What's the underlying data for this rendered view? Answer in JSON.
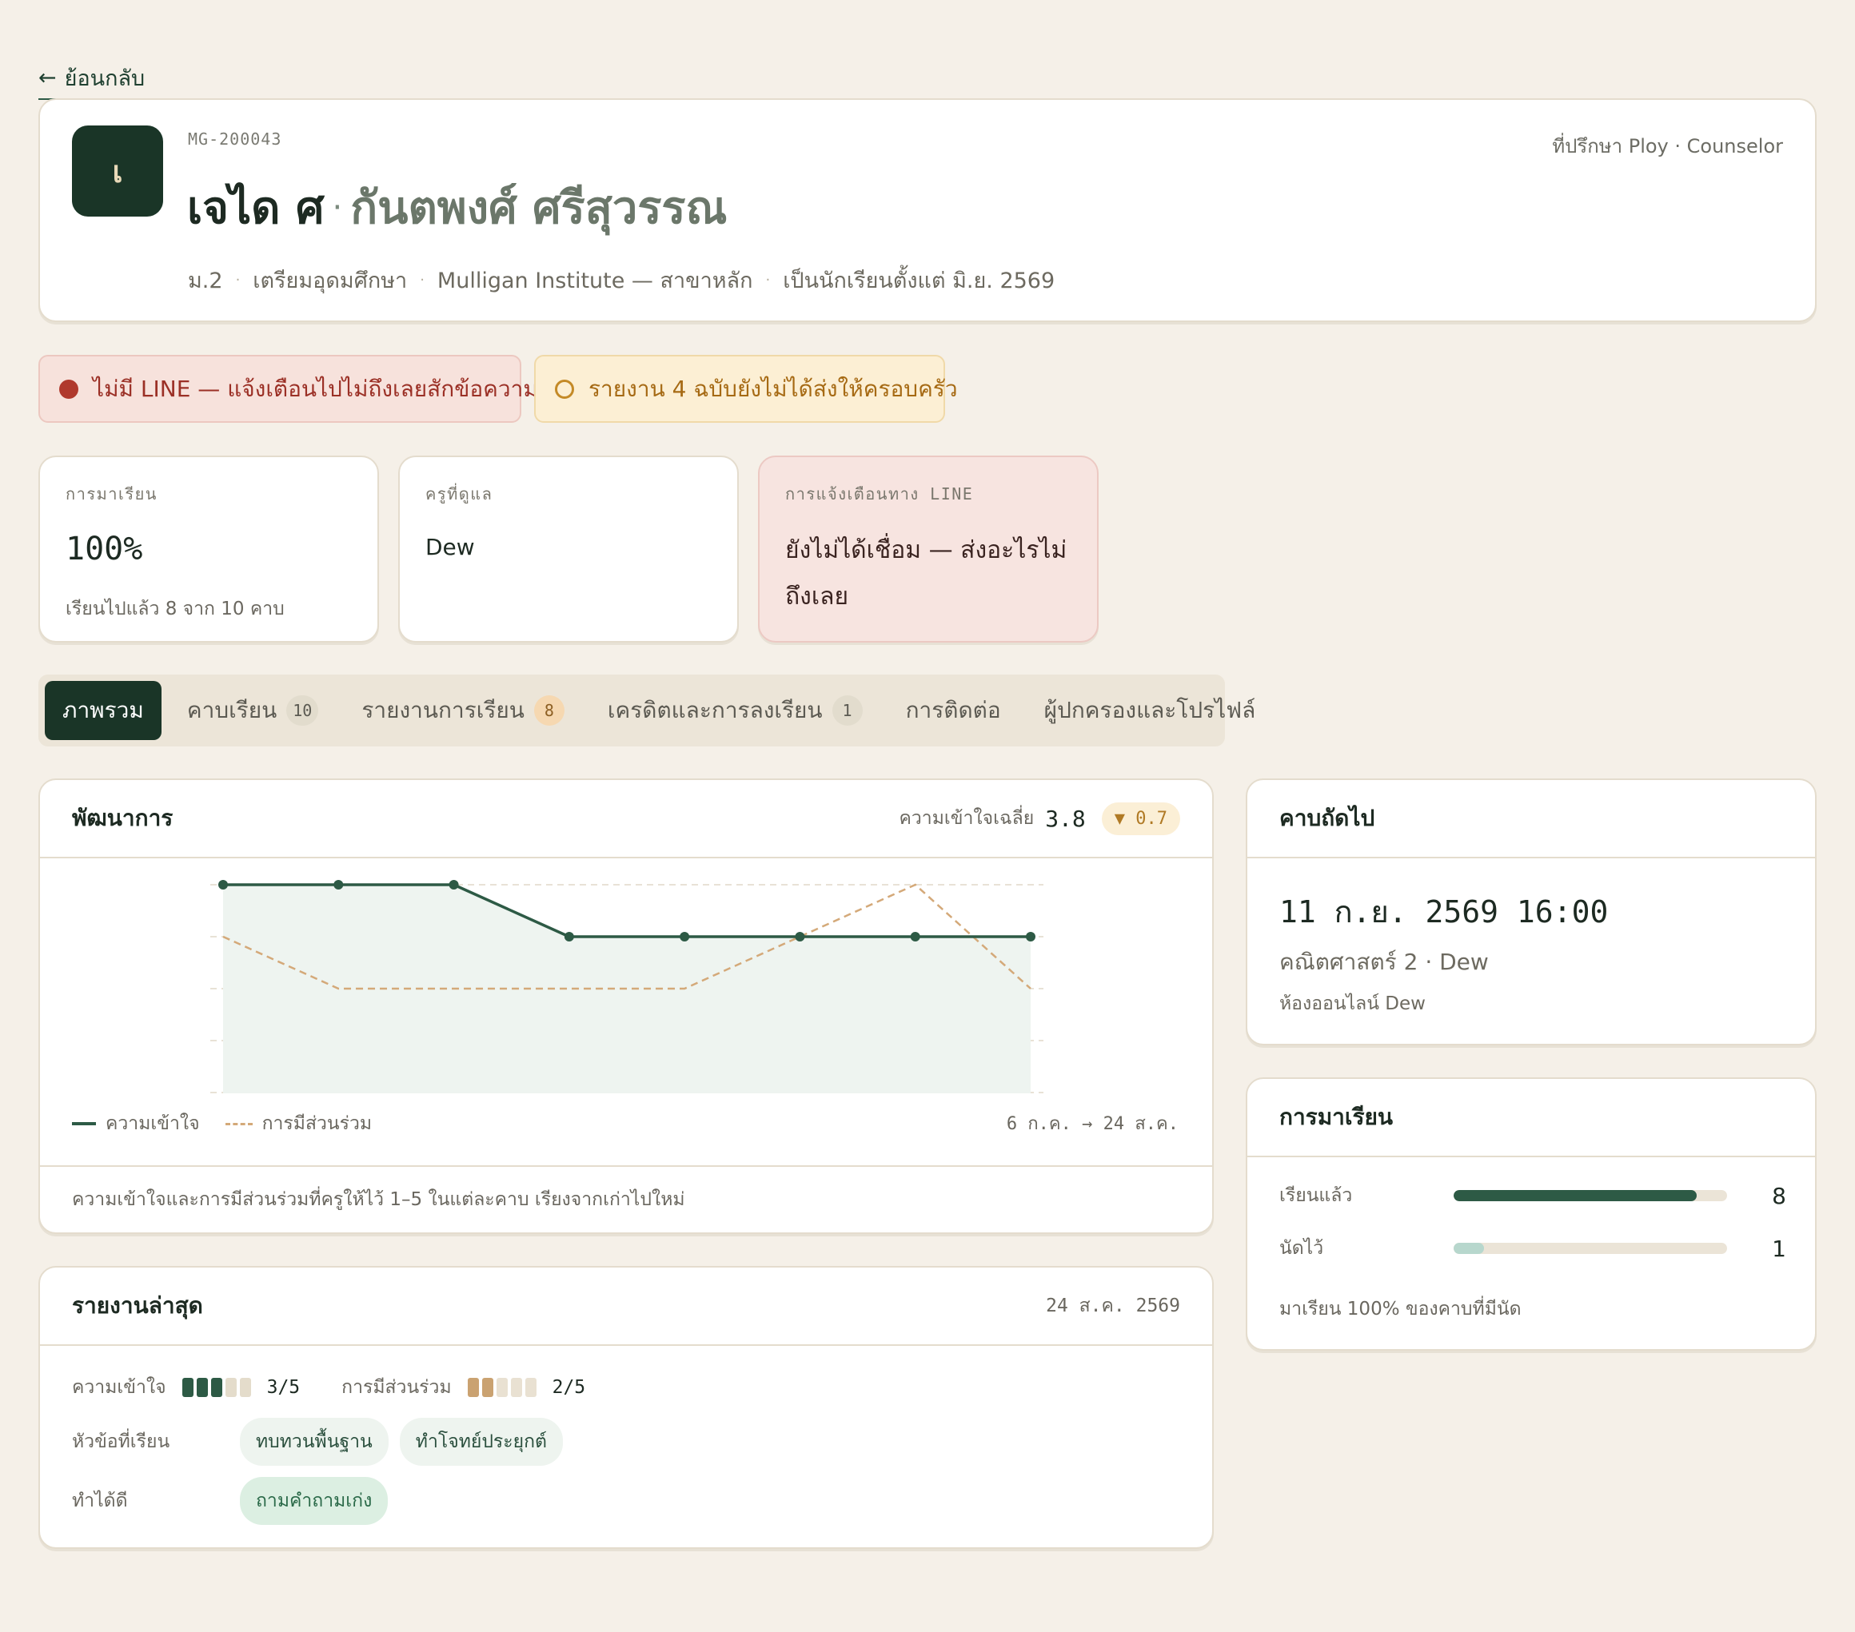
{
  "back_label": "ย้อนกลับ",
  "student": {
    "avatar_initial": "เ",
    "id": "MG-200043",
    "name_th": "เจได ศ",
    "name_separator": "·",
    "name_en": "กันตพงศ์ ศรีสุวรรณ",
    "counselor": "ที่ปรึกษา Ploy · Counselor",
    "meta": [
      "ม.2",
      "เตรียมอุดมศึกษา",
      "Mulligan Institute — สาขาหลัก",
      "เป็นนักเรียนตั้งแต่ มิ.ย. 2569"
    ],
    "meta_separator": "·"
  },
  "alerts": {
    "line": "ไม่มี LINE — แจ้งเตือนไปไม่ถึงเลยสักข้อความ",
    "reports": "รายงาน 4 ฉบับยังไม่ได้ส่งให้ครอบครัว"
  },
  "stats": {
    "attendance": {
      "label": "การมาเรียน",
      "value": "100%",
      "sub": "เรียนไปแล้ว 8 จาก 10 คาบ"
    },
    "teacher": {
      "label": "ครูที่ดูแล",
      "value": "Dew"
    },
    "line": {
      "label": "การแจ้งเตือนทาง LINE",
      "value": "ยังไม่ได้เชื่อม — ส่งอะไรไม่ถึงเลย"
    }
  },
  "tabs": [
    {
      "label": "ภาพรวม",
      "count": null,
      "active": true
    },
    {
      "label": "คาบเรียน",
      "count": "10",
      "active": false
    },
    {
      "label": "รายงานการเรียน",
      "count": "8",
      "active": false
    },
    {
      "label": "เครดิตและการลงเรียน",
      "count": "1",
      "active": false
    },
    {
      "label": "การติดต่อ",
      "count": null,
      "active": false
    },
    {
      "label": "ผู้ปกครองและโปรไฟล์",
      "count": null,
      "active": false
    }
  ],
  "progress": {
    "title": "พัฒนาการ",
    "avg_label": "ความเข้าใจเฉลี่ย",
    "avg_value": "3.8",
    "delta": "▼ 0.7",
    "legend_understanding": "ความเข้าใจ",
    "legend_participation": "การมีส่วนร่วม",
    "range": "6 ก.ค. → 24 ส.ค.",
    "footnote": "ความเข้าใจและการมีส่วนร่วมที่ครูให้ไว้ 1–5 ในแต่ละคาบ เรียงจากเก่าไปใหม่"
  },
  "chart_data": {
    "type": "line",
    "x": [
      1,
      2,
      3,
      4,
      5,
      6,
      7,
      8
    ],
    "ylim": [
      1,
      5
    ],
    "grid": true,
    "series": [
      {
        "name": "ความเข้าใจ",
        "values": [
          5,
          5,
          5,
          4,
          4,
          4,
          4,
          4
        ],
        "color": "#2d5a45"
      },
      {
        "name": "การมีส่วนร่วม",
        "values": [
          4,
          3,
          3,
          3,
          3,
          4,
          5,
          3
        ],
        "color": "#d4a979"
      }
    ]
  },
  "report": {
    "title": "รายงานล่าสุด",
    "date": "24 ส.ค. 2569",
    "understanding_label": "ความเข้าใจ",
    "understanding_score": 3,
    "understanding_text": "3/5",
    "participation_label": "การมีส่วนร่วม",
    "participation_score": 2,
    "participation_text": "2/5",
    "topics_label": "หัวข้อที่เรียน",
    "topics": [
      "ทบทวนพื้นฐาน",
      "ทำโจทย์ประยุกต์"
    ],
    "good_label": "ทำได้ดี",
    "good": [
      "ถามคำถามเก่ง"
    ]
  },
  "next_class": {
    "title": "คาบถัดไป",
    "datetime": "11 ก.ย. 2569 16:00",
    "subject": "คณิตศาสตร์ 2 · Dew",
    "room": "ห้องออนไลน์ Dew"
  },
  "attendance": {
    "title": "การมาเรียน",
    "attended_label": "เรียนแล้ว",
    "attended": 8,
    "scheduled_label": "นัดไว้",
    "scheduled": 1,
    "note": "มาเรียน 100% ของคาบที่มีนัด",
    "colors": {
      "attended": "#2d5a45",
      "scheduled": "#b7d7cd"
    }
  }
}
